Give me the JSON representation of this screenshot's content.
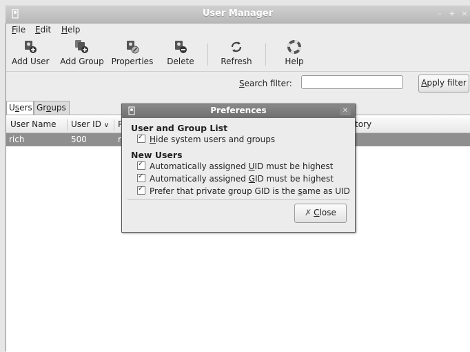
{
  "window": {
    "title": "User Manager"
  },
  "menubar": {
    "items": [
      {
        "pre": "",
        "u": "F",
        "post": "ile"
      },
      {
        "pre": "",
        "u": "E",
        "post": "dit"
      },
      {
        "pre": "",
        "u": "H",
        "post": "elp"
      }
    ]
  },
  "toolbar": {
    "add_user": "Add User",
    "add_group": "Add Group",
    "properties": "Properties",
    "delete": "Delete",
    "refresh": "Refresh",
    "help": "Help"
  },
  "filter": {
    "label_pre": "",
    "label_u": "S",
    "label_post": "earch filter:",
    "value": "",
    "apply_pre": "",
    "apply_u": "A",
    "apply_post": "pply filter"
  },
  "tabs": {
    "users_pre": "U",
    "users_u": "s",
    "users_post": "ers",
    "groups_pre": "Gr",
    "groups_u": "o",
    "groups_post": "ups"
  },
  "table": {
    "headers": {
      "user_name": "User Name",
      "user_id": "User ID",
      "sort_indicator": "∨",
      "col3": "P",
      "home": "tory"
    },
    "rows": [
      {
        "user_name": "rich",
        "user_id": "500",
        "col3": "ri"
      }
    ]
  },
  "dialog": {
    "title": "Preferences",
    "section1": "User and Group List",
    "opt_hide_pre": "",
    "opt_hide_u": "H",
    "opt_hide_post": "ide system users and groups",
    "section2": "New Users",
    "opt_uid_pre": "Automatically assigned ",
    "opt_uid_u": "U",
    "opt_uid_post": "ID must be highest",
    "opt_gid_pre": "Automatically assigned ",
    "opt_gid_u": "G",
    "opt_gid_post": "ID must be highest",
    "opt_private_pre": "Prefer that private group GID is the ",
    "opt_private_u": "s",
    "opt_private_post": "ame as UID",
    "close_pre": "",
    "close_u": "C",
    "close_post": "lose"
  }
}
